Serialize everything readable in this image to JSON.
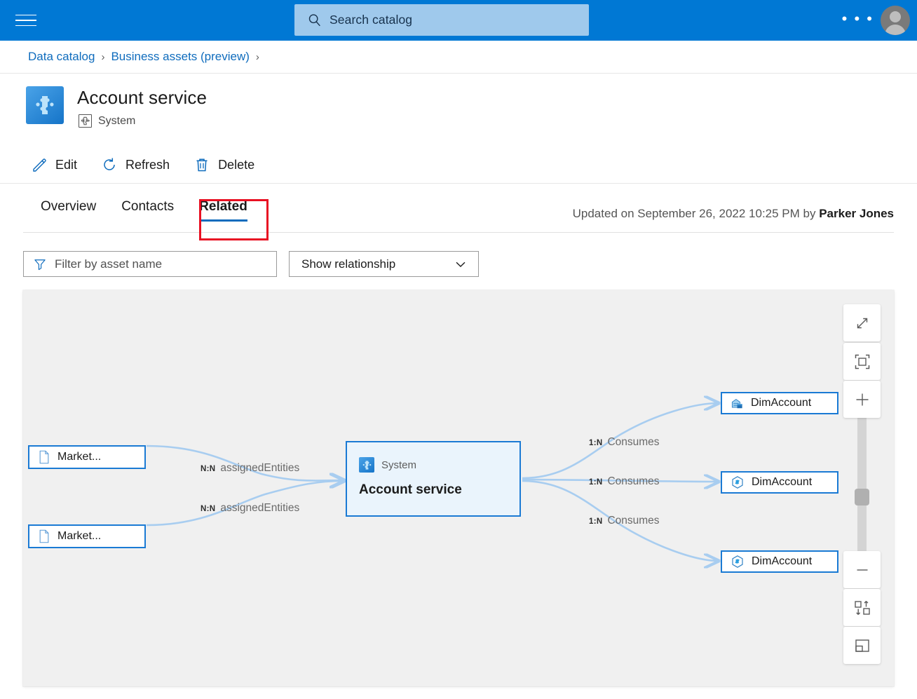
{
  "topnav": {
    "menu_icon": "hamburger-icon",
    "search": {
      "placeholder": "Search catalog",
      "icon": "search-icon"
    },
    "overflow_label": "• • •",
    "account_icon": "user-avatar-icon",
    "accent_color": "#0078d4"
  },
  "breadcrumb": {
    "items": [
      {
        "label": "Data catalog"
      },
      {
        "label": "Business assets (preview)"
      }
    ],
    "separator": "›"
  },
  "page_header": {
    "icon": "system-puzzle-icon",
    "title": "Account service",
    "type_icon": "system-outline-icon",
    "type_label": "System"
  },
  "command_bar": {
    "items": [
      {
        "label": "Edit",
        "icon": "pencil-icon"
      },
      {
        "label": "Refresh",
        "icon": "refresh-icon"
      },
      {
        "label": "Delete",
        "icon": "trash-icon"
      }
    ]
  },
  "tabs": {
    "items": [
      {
        "label": "Overview",
        "active": false
      },
      {
        "label": "Contacts",
        "active": false
      },
      {
        "label": "Related",
        "active": true
      }
    ],
    "highlight_color": "#e81123",
    "active_underline_color": "#0f6cbd"
  },
  "updated": {
    "prefix": "Updated on September 26, 2022 10:25 PM by ",
    "user": "Parker Jones"
  },
  "filters": {
    "asset_filter": {
      "placeholder": "Filter by asset name",
      "value": "",
      "icon": "filter-icon"
    },
    "relationship_select": {
      "value": "Show relationship",
      "icon": "chevron-down-icon"
    }
  },
  "graph": {
    "background_color": "#f0f0f0",
    "node_border_color": "#1a7ad4",
    "edge_color": "#a8cdf0",
    "nodes": [
      {
        "id": "left1",
        "label": "Market...",
        "icon": "document-icon",
        "kind": "left"
      },
      {
        "id": "left2",
        "label": "Market...",
        "icon": "document-icon",
        "kind": "left"
      },
      {
        "id": "center",
        "type_label": "System",
        "label": "Account service",
        "icon": "system-puzzle-icon",
        "kind": "center"
      },
      {
        "id": "right1",
        "label": "DimAccount",
        "icon": "warehouse-table-icon",
        "kind": "right"
      },
      {
        "id": "right2",
        "label": "DimAccount",
        "icon": "hexagon-data-icon",
        "kind": "right"
      },
      {
        "id": "right3",
        "label": "DimAccount",
        "icon": "hexagon-data-icon",
        "kind": "right"
      }
    ],
    "edges": [
      {
        "cardinality": "N:N",
        "relationship": "assignedEntities"
      },
      {
        "cardinality": "N:N",
        "relationship": "assignedEntities"
      },
      {
        "cardinality": "1:N",
        "relationship": "Consumes"
      },
      {
        "cardinality": "1:N",
        "relationship": "Consumes"
      },
      {
        "cardinality": "1:N",
        "relationship": "Consumes"
      }
    ],
    "controls": [
      {
        "name": "expand-button",
        "icon": "expand-diagonal-icon"
      },
      {
        "name": "fit-to-view-button",
        "icon": "fit-frame-icon"
      },
      {
        "name": "zoom-in-button",
        "icon": "plus-icon"
      },
      {
        "name": "zoom-out-button",
        "icon": "minus-icon"
      },
      {
        "name": "toggle-layout-direction-button",
        "icon": "swap-layout-icon"
      },
      {
        "name": "toggle-minimap-button",
        "icon": "minimap-panel-icon"
      }
    ]
  }
}
